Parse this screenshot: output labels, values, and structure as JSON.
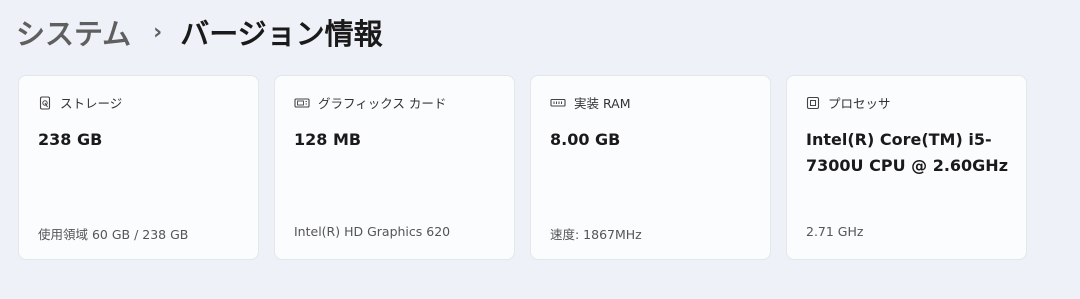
{
  "breadcrumb": {
    "parent": "システム",
    "separator": "›",
    "current": "バージョン情報"
  },
  "cards": [
    {
      "icon": "storage-drive-icon",
      "label": "ストレージ",
      "value": "238 GB",
      "detail": "使用領域 60 GB / 238 GB"
    },
    {
      "icon": "graphics-card-icon",
      "label": "グラフィックス カード",
      "value": "128 MB",
      "detail": "Intel(R) HD Graphics 620"
    },
    {
      "icon": "memory-ram-icon",
      "label": "実装 RAM",
      "value": "8.00 GB",
      "detail": "速度: 1867MHz"
    },
    {
      "icon": "processor-chip-icon",
      "label": "プロセッサ",
      "value": "Intel(R) Core(TM) i5-7300U CPU @ 2.60GHz",
      "detail": "2.71 GHz"
    }
  ]
}
